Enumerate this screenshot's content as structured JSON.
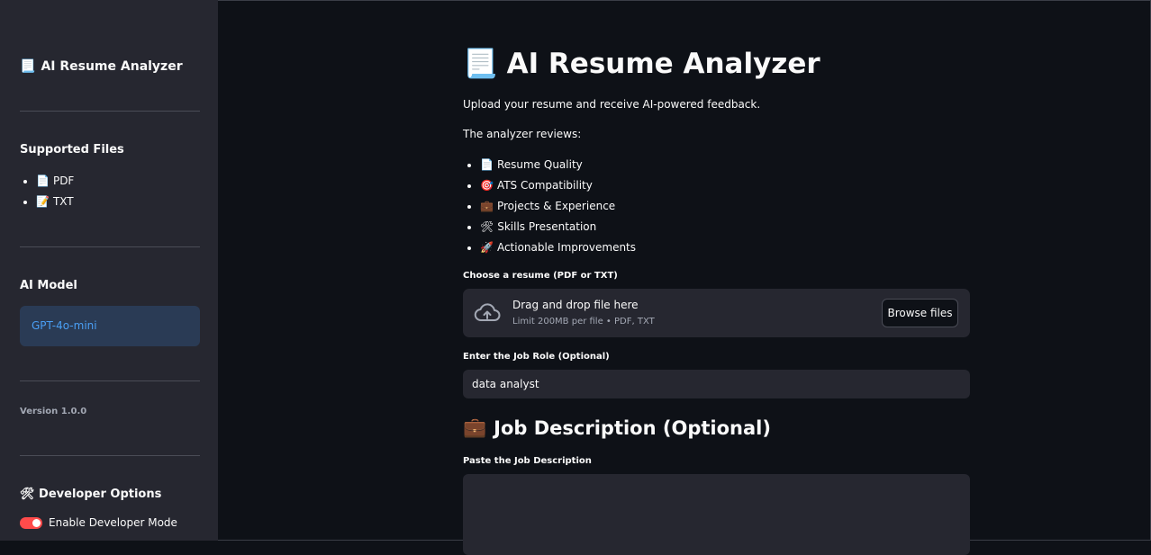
{
  "sidebar": {
    "title_icon": "📃",
    "title": "AI Resume Analyzer",
    "supported_heading": "Supported Files",
    "files": [
      {
        "icon": "📄",
        "label": "PDF"
      },
      {
        "icon": "📝",
        "label": "TXT"
      }
    ],
    "model_heading": "AI Model",
    "model_value": "GPT-4o-mini",
    "version": "Version 1.0.0",
    "dev_heading_icon": "🛠",
    "dev_heading": "Developer Options",
    "dev_toggle_label": "Enable Developer Mode",
    "dev_toggle_on": true
  },
  "main": {
    "title_icon": "📃",
    "title": "AI Resume Analyzer",
    "intro": "Upload your resume and receive AI-powered feedback.",
    "reviews_heading": "The analyzer reviews:",
    "features": [
      {
        "icon": "📄",
        "label": "Resume Quality"
      },
      {
        "icon": "🎯",
        "label": "ATS Compatibility"
      },
      {
        "icon": "💼",
        "label": "Projects & Experience"
      },
      {
        "icon": "🛠",
        "label": "Skills Presentation"
      },
      {
        "icon": "🚀",
        "label": "Actionable Improvements"
      }
    ],
    "upload_label": "Choose a resume (PDF or TXT)",
    "upload_icon": "cloud-upload-icon",
    "upload_main": "Drag and drop file here",
    "upload_sub": "Limit 200MB per file • PDF, TXT",
    "browse_label": "Browse files",
    "job_role_label": "Enter the Job Role (Optional)",
    "job_role_value": "data analyst",
    "jd_heading_icon": "💼",
    "jd_heading": "Job Description (Optional)",
    "jd_label": "Paste the Job Description",
    "jd_value": ""
  },
  "colors": {
    "background": "#0e1117",
    "sidebar": "#262730",
    "model_box": "#2a3b55",
    "model_text": "#4a9ff5",
    "toggle_on": "#ff4b4b"
  }
}
